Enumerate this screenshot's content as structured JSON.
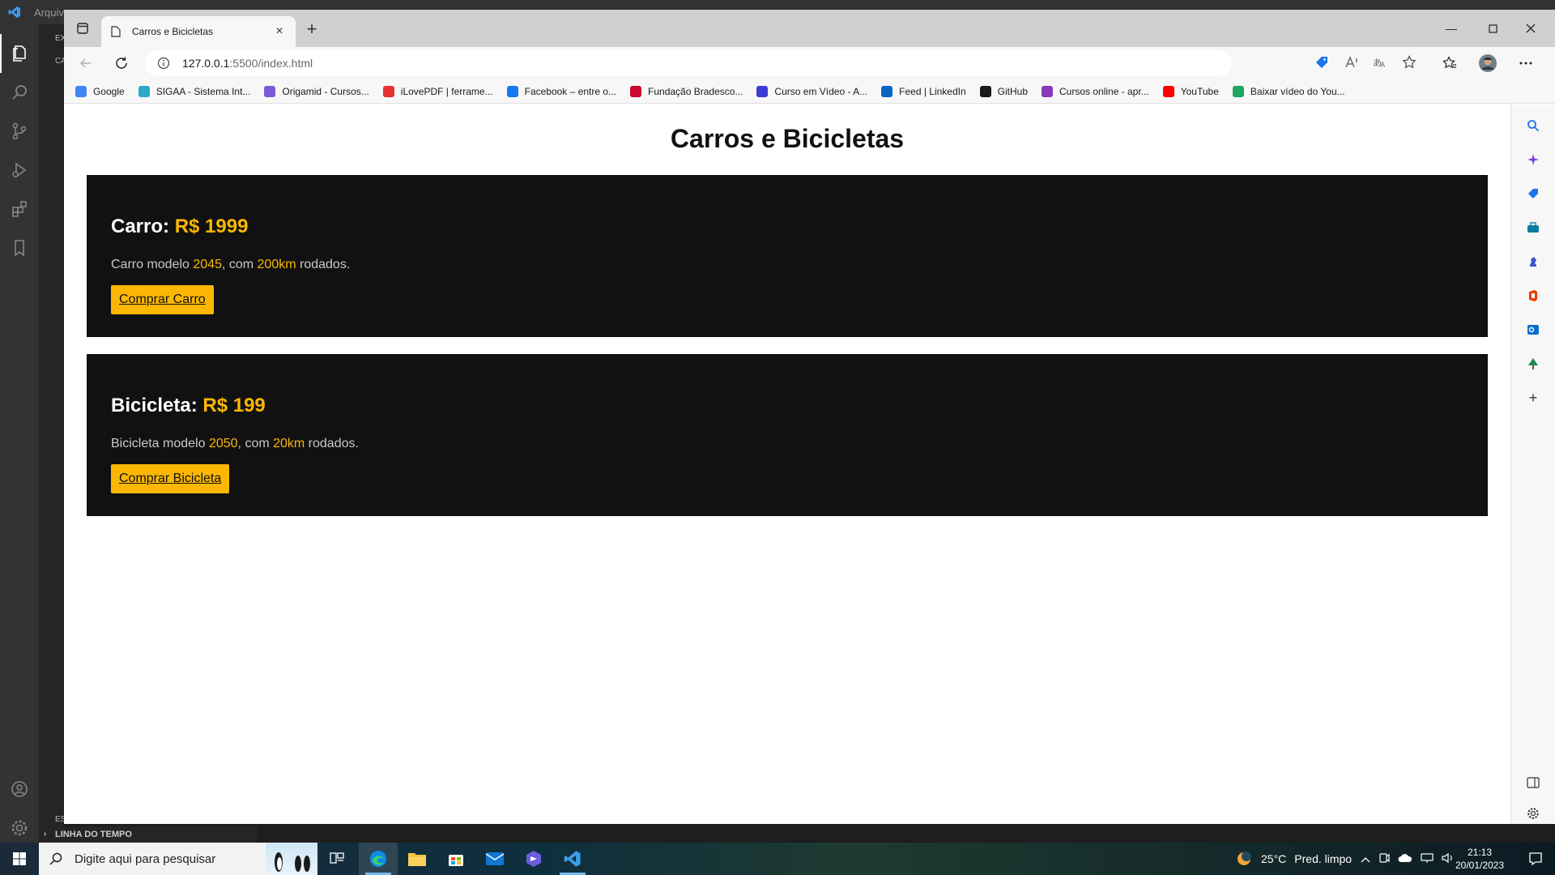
{
  "vscode": {
    "menu_label": "Arquivo",
    "sidebar_texts": [
      "EX",
      "CA",
      "ES"
    ],
    "timeline_label": "LINHA DO TEMPO"
  },
  "browser": {
    "tab_title": "Carros e Bicicletas",
    "url_host": "127.0.0.1",
    "url_path": ":5500/index.html",
    "bookmarks": [
      {
        "label": "Google",
        "color": "#4285f4"
      },
      {
        "label": "SIGAA - Sistema Int...",
        "color": "#2aa8c8"
      },
      {
        "label": "Origamid - Cursos...",
        "color": "#7b5ad8"
      },
      {
        "label": "iLovePDF | ferrame...",
        "color": "#e5322d"
      },
      {
        "label": "Facebook – entre o...",
        "color": "#1877f2"
      },
      {
        "label": "Fundação Bradesco...",
        "color": "#cc092f"
      },
      {
        "label": "Curso em Vídeo - A...",
        "color": "#3b3bd6"
      },
      {
        "label": "Feed | LinkedIn",
        "color": "#0a66c2"
      },
      {
        "label": "GitHub",
        "color": "#1a1a1a"
      },
      {
        "label": "Cursos online - apr...",
        "color": "#8a3ab9"
      },
      {
        "label": "YouTube",
        "color": "#ff0000"
      },
      {
        "label": "Baixar vídeo do You...",
        "color": "#1fa463"
      }
    ]
  },
  "page": {
    "heading": "Carros e Bicicletas",
    "cards": [
      {
        "title": "Carro:",
        "price": "R$ 1999",
        "desc_pre": "Carro modelo ",
        "model": "2045",
        "desc_mid": ", com ",
        "km": "200km",
        "desc_post": " rodados.",
        "button": "Comprar Carro"
      },
      {
        "title": "Bicicleta:",
        "price": "R$ 199",
        "desc_pre": "Bicicleta modelo ",
        "model": "2050",
        "desc_mid": ", com ",
        "km": "20km",
        "desc_post": " rodados.",
        "button": "Comprar Bicicleta"
      }
    ],
    "accent_color": "#fbb703"
  },
  "taskbar": {
    "search_placeholder": "Digite aqui para pesquisar",
    "weather_temp": "25°C",
    "weather_text": "Pred. limpo",
    "time": "21:13",
    "date": "20/01/2023"
  }
}
